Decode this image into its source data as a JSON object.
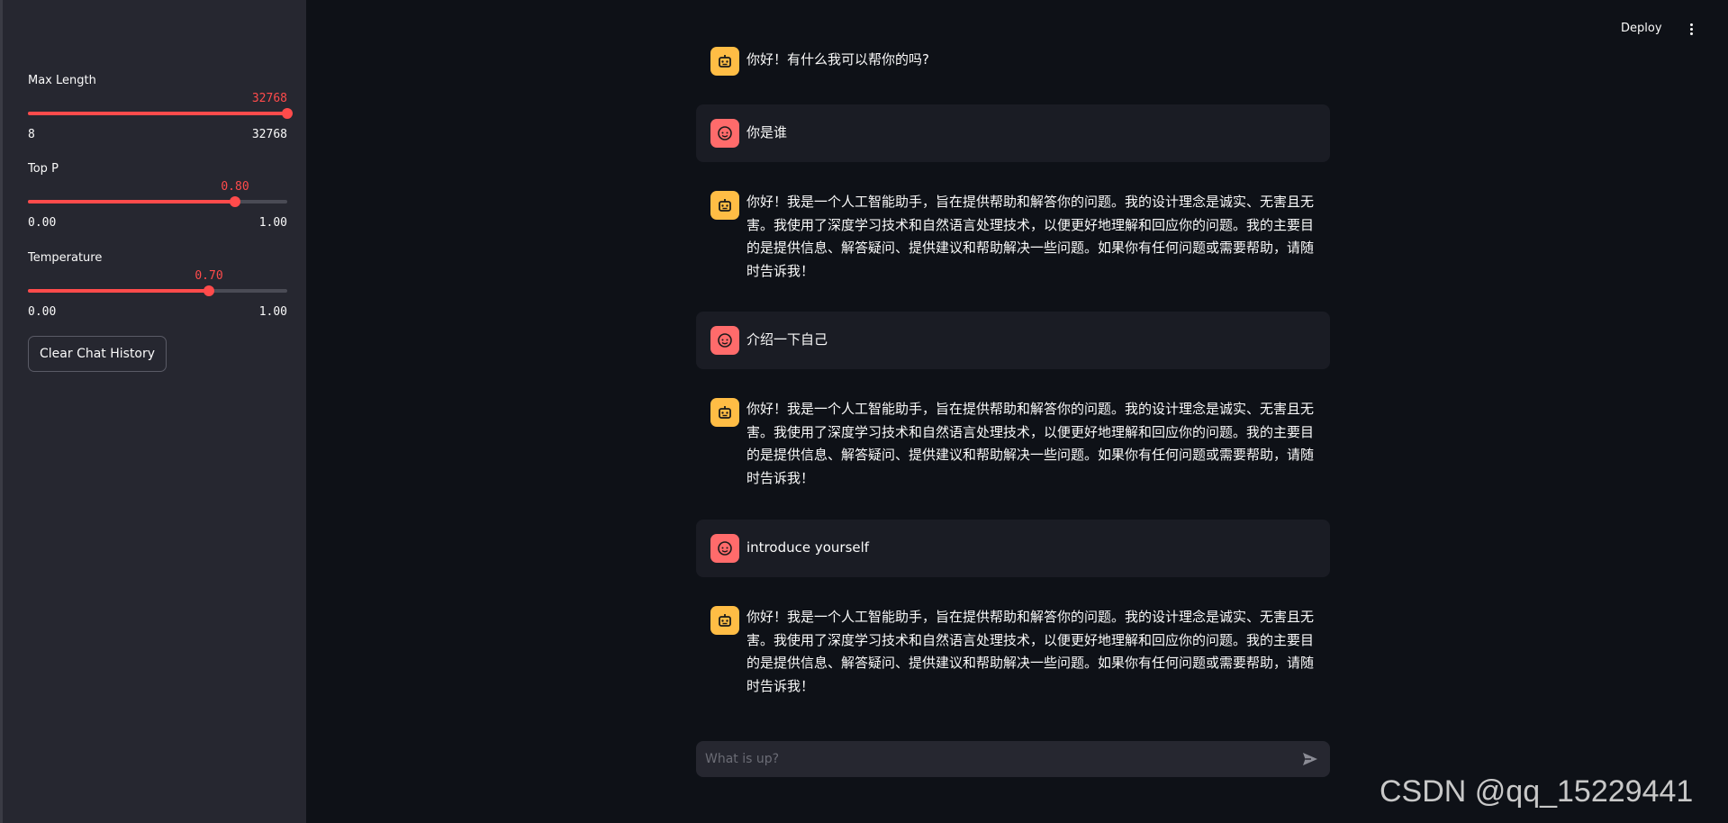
{
  "sidebar": {
    "sliders": [
      {
        "label": "Max Length",
        "value": "32768",
        "min": "8",
        "max": "32768",
        "fraction": 1.0
      },
      {
        "label": "Top P",
        "value": "0.80",
        "min": "0.00",
        "max": "1.00",
        "fraction": 0.8
      },
      {
        "label": "Temperature",
        "value": "0.70",
        "min": "0.00",
        "max": "1.00",
        "fraction": 0.7
      }
    ],
    "clear_button": "Clear Chat History"
  },
  "header": {
    "deploy_label": "Deploy",
    "menu_icon": "vertical-dots-icon"
  },
  "messages": [
    {
      "role": "assistant",
      "text": "你好！有什么我可以帮你的吗?"
    },
    {
      "role": "user",
      "text": "你是谁"
    },
    {
      "role": "assistant",
      "text": "你好！我是一个人工智能助手，旨在提供帮助和解答你的问题。我的设计理念是诚实、无害且无害。我使用了深度学习技术和自然语言处理技术，以便更好地理解和回应你的问题。我的主要目的是提供信息、解答疑问、提供建议和帮助解决一些问题。如果你有任何问题或需要帮助，请随时告诉我！"
    },
    {
      "role": "user",
      "text": "介绍一下自己"
    },
    {
      "role": "assistant",
      "text": "你好！我是一个人工智能助手，旨在提供帮助和解答你的问题。我的设计理念是诚实、无害且无害。我使用了深度学习技术和自然语言处理技术，以便更好地理解和回应你的问题。我的主要目的是提供信息、解答疑问、提供建议和帮助解决一些问题。如果你有任何问题或需要帮助，请随时告诉我！"
    },
    {
      "role": "user",
      "text": "introduce yourself"
    },
    {
      "role": "assistant",
      "text": "你好！我是一个人工智能助手，旨在提供帮助和解答你的问题。我的设计理念是诚实、无害且无害。我使用了深度学习技术和自然语言处理技术，以便更好地理解和回应你的问题。我的主要目的是提供信息、解答疑问、提供建议和帮助解决一些问题。如果你有任何问题或需要帮助，请随时告诉我！"
    }
  ],
  "input": {
    "placeholder": "What is up?",
    "send_icon": "send-icon"
  },
  "watermark": "CSDN @qq_15229441",
  "colors": {
    "accent": "#ff4b4b",
    "user_avatar": "#ff6b6b",
    "assistant_avatar": "#ffbd45",
    "background": "#0e1117",
    "sidebar": "#262730"
  }
}
